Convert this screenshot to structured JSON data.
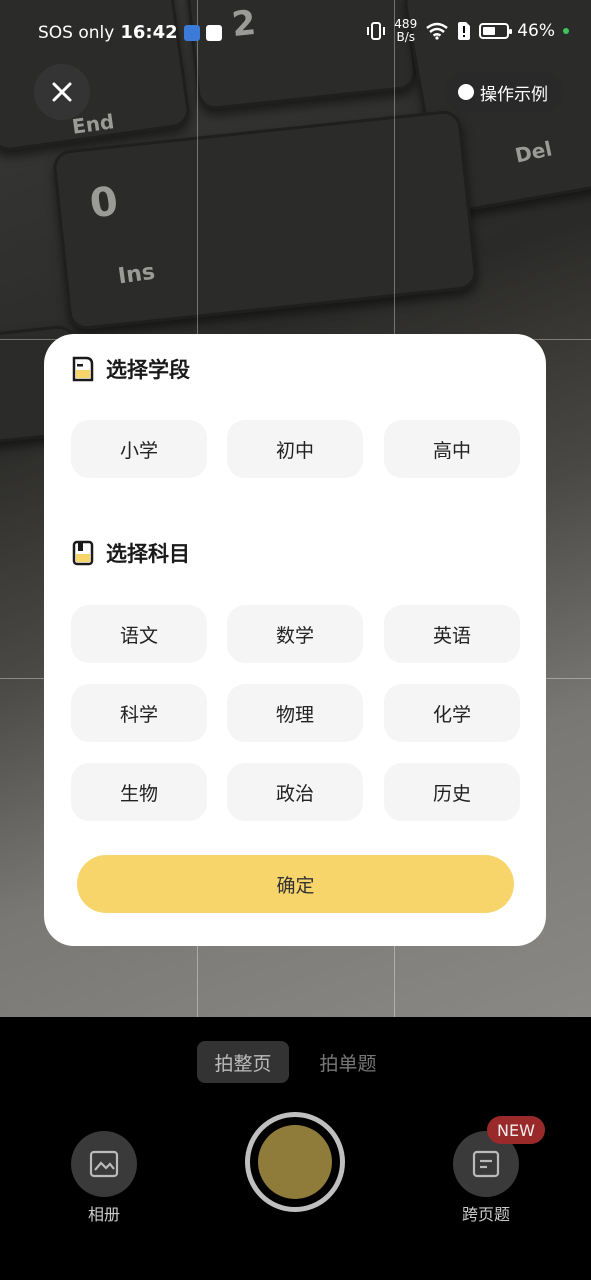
{
  "status_bar": {
    "carrier": "SOS only",
    "time": "16:42",
    "net_speed_value": "489",
    "net_speed_unit": "B/s",
    "battery": "46%"
  },
  "camera": {
    "example_label": "操作示例"
  },
  "dialog": {
    "grade_title": "选择学段",
    "grades": [
      "小学",
      "初中",
      "高中"
    ],
    "subject_title": "选择科目",
    "subjects": [
      "语文",
      "数学",
      "英语",
      "科学",
      "物理",
      "化学",
      "生物",
      "政治",
      "历史"
    ],
    "confirm_label": "确定"
  },
  "bottom": {
    "mode_whole_page": "拍整页",
    "mode_single": "拍单题",
    "album_label": "相册",
    "cross_page_label": "跨页题",
    "new_badge": "NEW"
  },
  "colors": {
    "accent": "#f7d56a",
    "chip_bg": "#f5f5f5",
    "shutter_inner": "#8f7c3a",
    "badge": "#9a2a2a"
  }
}
